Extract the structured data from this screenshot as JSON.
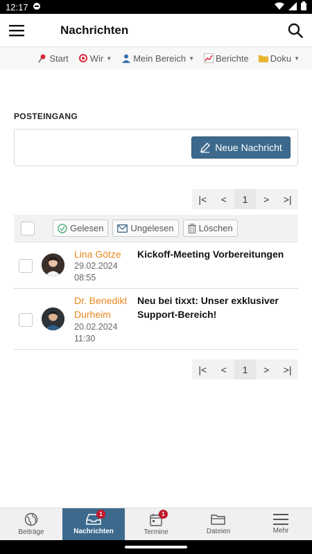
{
  "status": {
    "time": "12:17"
  },
  "header": {
    "title": "Nachrichten"
  },
  "subnav": {
    "items": [
      {
        "icon": "pin-icon",
        "label": "Start",
        "dropdown": false
      },
      {
        "icon": "target-icon",
        "label": "Wir",
        "dropdown": true
      },
      {
        "icon": "person-icon",
        "label": "Mein Bereich",
        "dropdown": true
      },
      {
        "icon": "chart-icon",
        "label": "Berichte",
        "dropdown": false
      },
      {
        "icon": "folder-icon",
        "label": "Doku",
        "dropdown": true
      }
    ]
  },
  "inbox": {
    "title": "POSTEINGANG",
    "new_message_label": "Neue Nachricht",
    "page_current": "1",
    "actions": {
      "read": "Gelesen",
      "unread": "Ungelesen",
      "delete": "Löschen"
    },
    "messages": [
      {
        "sender": "Lina Götze",
        "date": "29.02.2024",
        "time": "08:55",
        "subject": "Kickoff-Meeting Vorbereitungen"
      },
      {
        "sender": "Dr. Benedikt Durheim",
        "date": "20.02.2024",
        "time": "11:30",
        "subject": "Neu bei tixxt: Unser exklusiver Support-Bereich!"
      }
    ]
  },
  "bottomnav": {
    "items": [
      {
        "label": "Beiträge",
        "icon": "globe-icon",
        "active": false,
        "badge": ""
      },
      {
        "label": "Nachrichten",
        "icon": "inbox-icon",
        "active": true,
        "badge": "1"
      },
      {
        "label": "Termine",
        "icon": "calendar-icon",
        "active": false,
        "badge": "1"
      },
      {
        "label": "Dateien",
        "icon": "folder-icon",
        "active": false,
        "badge": ""
      },
      {
        "label": "Mehr",
        "icon": "menu-icon",
        "active": false,
        "badge": ""
      }
    ]
  },
  "colors": {
    "accent": "#3d6a8c",
    "sender": "#e8871e",
    "badge": "#c0182b"
  }
}
